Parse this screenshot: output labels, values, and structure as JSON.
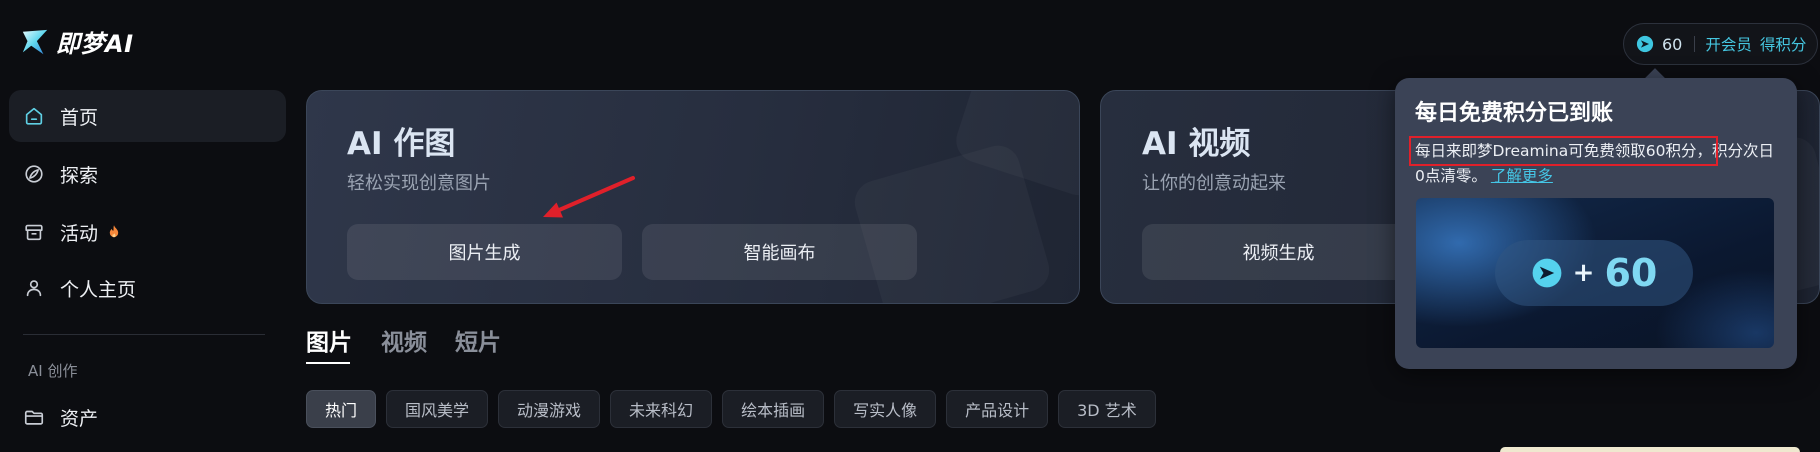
{
  "app": {
    "logo_text": "即梦AI",
    "logo_icon": "dreamina-logo-icon",
    "colors": {
      "background": "#0c0d11",
      "accent": "#3ec6e0",
      "card": "#2f374a",
      "popup": "#3b4356",
      "annotation_red": "#e0202a"
    }
  },
  "sidebar": {
    "items": [
      {
        "label": "首页",
        "icon": "home-icon",
        "active": true
      },
      {
        "label": "探索",
        "icon": "compass-icon"
      },
      {
        "label": "活动",
        "icon": "gift-box-icon",
        "badge_icon": "flame-icon"
      },
      {
        "label": "个人主页",
        "icon": "user-icon"
      }
    ],
    "section_label": "AI 创作",
    "section_items": [
      {
        "label": "资产",
        "icon": "folder-icon"
      }
    ]
  },
  "header": {
    "credits": {
      "icon": "credit-icon",
      "value": "60",
      "membership_link": "开会员",
      "earn_link": "得积分"
    }
  },
  "cards": [
    {
      "title": "AI 作图",
      "subtitle": "轻松实现创意图片",
      "buttons": [
        "图片生成",
        "智能画布"
      ]
    },
    {
      "title": "AI 视频",
      "subtitle": "让你的创意动起来",
      "buttons": [
        "视频生成"
      ]
    }
  ],
  "popup": {
    "title": "每日免费积分已到账",
    "highlighted_text": "每日来即梦Dreamina可免费领取60积分，",
    "text": "积分次日0点清零。",
    "link": "了解更多",
    "banner": {
      "icon": "credit-icon",
      "plus": "+",
      "amount": "60"
    }
  },
  "content_tabs": {
    "tabs": [
      {
        "label": "图片",
        "active": true
      },
      {
        "label": "视频"
      },
      {
        "label": "短片"
      }
    ]
  },
  "categories": {
    "chips": [
      {
        "label": "热门",
        "active": true
      },
      {
        "label": "国风美学"
      },
      {
        "label": "动漫游戏"
      },
      {
        "label": "未来科幻"
      },
      {
        "label": "绘本插画"
      },
      {
        "label": "写实人像"
      },
      {
        "label": "产品设计"
      },
      {
        "label": "3D 艺术"
      }
    ]
  }
}
